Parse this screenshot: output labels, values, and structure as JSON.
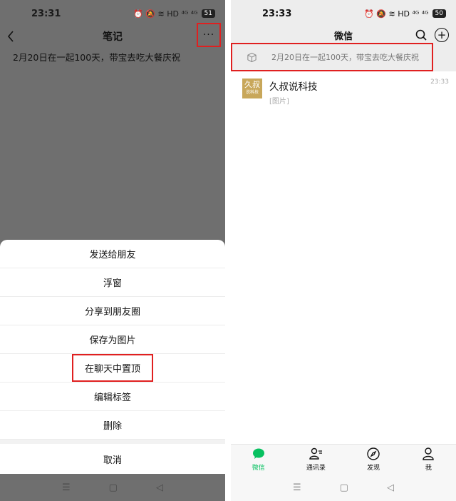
{
  "left": {
    "status": {
      "time": "23:31",
      "icons": "⏰ 🔕 ≋ HD ⁴ᴳ ⁴ᴳ",
      "battery": "51"
    },
    "nav": {
      "title": "笔记",
      "more": "···"
    },
    "note": {
      "text": "2月20日在一起100天，带宝去吃大餐庆祝"
    },
    "sheet": {
      "items": [
        "发送给朋友",
        "浮窗",
        "分享到朋友圈",
        "保存为图片",
        "在聊天中置顶",
        "编辑标签",
        "删除"
      ],
      "cancel": "取消"
    },
    "sysnav": {
      "menu": "☰",
      "home": "▢",
      "back": "◁"
    }
  },
  "right": {
    "status": {
      "time": "23:33",
      "icons": "⏰ 🔕 ≋ HD ⁴ᴳ ⁴ᴳ",
      "battery": "50"
    },
    "header": {
      "title": "微信",
      "plus": "+"
    },
    "pinned": {
      "text": "2月20日在一起100天，带宝去吃大餐庆祝"
    },
    "chat": {
      "name": "久叔说科技",
      "preview": "[图片]",
      "time": "23:33",
      "avatar_top": "久叔",
      "avatar_bottom": "说科技"
    },
    "tabs": [
      {
        "label": "微信",
        "active": true
      },
      {
        "label": "通讯录",
        "active": false
      },
      {
        "label": "发现",
        "active": false
      },
      {
        "label": "我",
        "active": false
      }
    ],
    "sysnav": {
      "menu": "☰",
      "home": "▢",
      "back": "◁"
    }
  },
  "colors": {
    "accent": "#07c160",
    "highlight": "#e02020",
    "overlay": "#6f6f6f"
  }
}
